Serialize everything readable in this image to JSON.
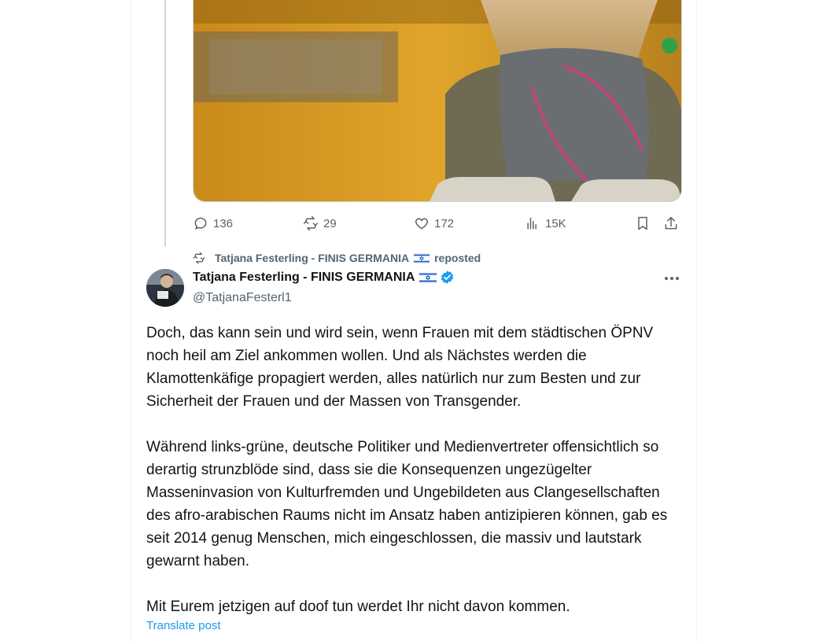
{
  "quoted_post": {
    "media_alt": "",
    "actions": {
      "replies": "136",
      "reposts": "29",
      "likes": "172",
      "views": "15K"
    }
  },
  "repost_context": {
    "text": "Tatjana Festerling - FINIS GERMANIA",
    "suffix": "reposted",
    "flag": "israel-flag"
  },
  "post": {
    "author_name": "Tatjana Festerling - FINIS GERMANIA",
    "handle": "@TatjanaFesterl1",
    "verified": true,
    "paragraphs": [
      "Doch, das kann sein und wird sein, wenn Frauen mit dem städtischen ÖPNV noch heil am Ziel ankommen wollen. Und als Nächstes werden die Klamottenkäfige propagiert werden, alles natürlich nur zum Besten und zur Sicherheit der Frauen und der Massen von Transgender.",
      "Während links-grüne, deutsche Politiker und Medienvertreter offensichtlich so derartig strunzblöde sind, dass sie die Konsequenzen ungezügelter Masseninvasion von Kulturfremden und Ungebildeten aus Clangesellschaften des afro-arabischen Raums nicht im Ansatz haben antizipieren können, gab es seit 2014 genug Menschen, mich eingeschlossen, die massiv und lautstark gewarnt haben.",
      "Mit Eurem jetzigen auf doof tun werdet Ihr nicht davon kommen."
    ],
    "translate_label": "Translate post"
  },
  "colors": {
    "text": "#0f1419",
    "secondary": "#536471",
    "accent": "#1d9bf0",
    "border": "#eff3f4"
  }
}
